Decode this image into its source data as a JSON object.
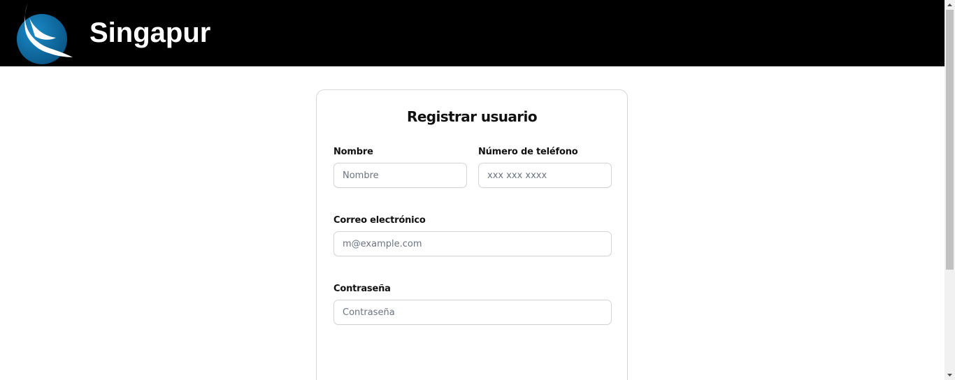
{
  "header": {
    "title": "Singapur",
    "logo": "bird-circle-logo",
    "background": "#000000",
    "logo_colors": {
      "circle": "#0b6aa2",
      "bird": "#ffffff"
    }
  },
  "form": {
    "title": "Registrar usuario",
    "fields": {
      "name": {
        "label": "Nombre",
        "placeholder": "Nombre",
        "value": ""
      },
      "phone": {
        "label": "Número de teléfono",
        "placeholder": "xxx xxx xxxx",
        "value": ""
      },
      "email": {
        "label": "Correo electrónico",
        "placeholder": "m@example.com",
        "value": ""
      },
      "password": {
        "label": "Contraseña",
        "placeholder": "Contraseña",
        "value": ""
      }
    }
  },
  "scrollbar": {
    "up_icon": "triangle-up-icon",
    "down_icon": "triangle-down-icon"
  }
}
